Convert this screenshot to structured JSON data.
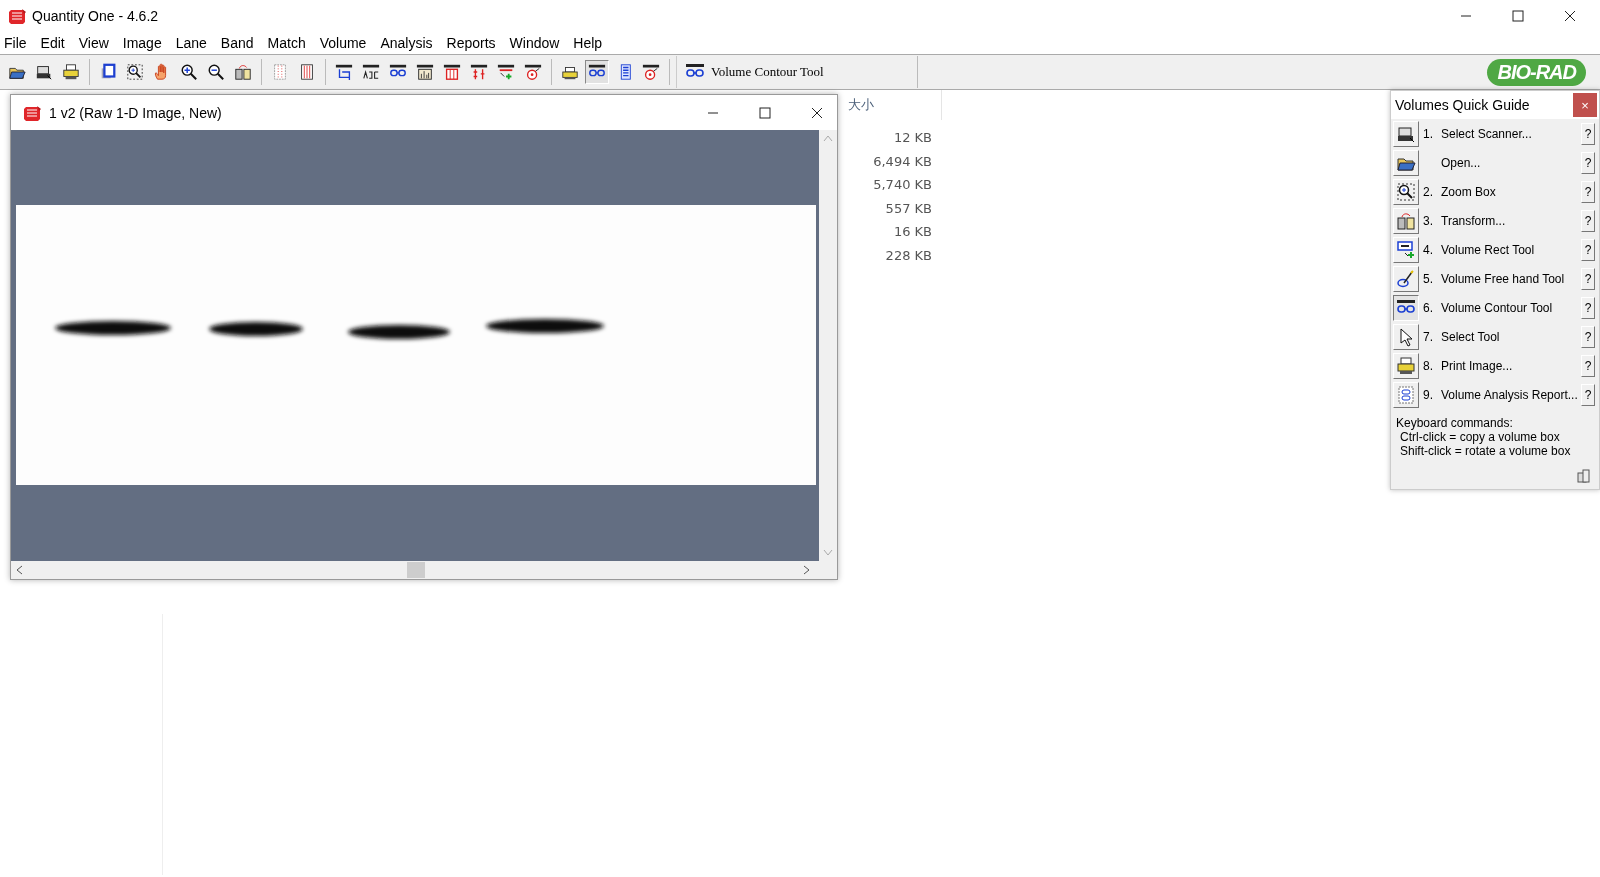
{
  "app": {
    "title": "Quantity One - 4.6.2"
  },
  "menu": [
    "File",
    "Edit",
    "View",
    "Image",
    "Lane",
    "Band",
    "Match",
    "Volume",
    "Analysis",
    "Reports",
    "Window",
    "Help"
  ],
  "toolbar": {
    "groups": [
      [
        {
          "kind": "open",
          "selected": false
        },
        {
          "kind": "scanner",
          "selected": false
        },
        {
          "kind": "print",
          "selected": false
        }
      ],
      [
        {
          "kind": "copy",
          "selected": false
        },
        {
          "kind": "zoom-box",
          "selected": false
        },
        {
          "kind": "hand",
          "selected": false
        },
        {
          "kind": "zoom-in",
          "selected": false
        },
        {
          "kind": "zoom-out",
          "selected": false
        },
        {
          "kind": "transform",
          "selected": false
        }
      ],
      [
        {
          "kind": "lanes-dotted",
          "selected": false
        },
        {
          "kind": "lanes",
          "selected": false
        }
      ],
      [
        {
          "kind": "crop-lane",
          "selected": false
        },
        {
          "kind": "label-lane",
          "selected": false
        },
        {
          "kind": "contour",
          "selected": false
        },
        {
          "kind": "histogram",
          "selected": false
        },
        {
          "kind": "lane-frame",
          "selected": false
        },
        {
          "kind": "band-match",
          "selected": false
        },
        {
          "kind": "add-band",
          "selected": false
        },
        {
          "kind": "target",
          "selected": false
        }
      ],
      [
        {
          "kind": "help-print",
          "selected": false
        },
        {
          "kind": "help-contour",
          "selected": true
        },
        {
          "kind": "help-list",
          "selected": false
        },
        {
          "kind": "help-target",
          "selected": false
        }
      ]
    ],
    "status": "Volume Contour Tool",
    "logo": "BIO-RAD"
  },
  "image_window": {
    "title": "1 v2 (Raw 1-D Image, New)"
  },
  "file_list": {
    "column_header": "大小",
    "sizes": [
      "12 KB",
      "6,494 KB",
      "5,740 KB",
      "557 KB",
      "16 KB",
      "228 KB"
    ]
  },
  "quick_guide": {
    "title": "Volumes Quick Guide",
    "close": "×",
    "items": [
      {
        "kind": "scanner",
        "number": "1.",
        "label": "Select Scanner...",
        "help": "?",
        "selected": false
      },
      {
        "kind": "open",
        "label": "Open...",
        "help": "?",
        "selected": false
      },
      {
        "kind": "zoom-box",
        "number": "2.",
        "label": "Zoom Box",
        "help": "?",
        "selected": false
      },
      {
        "kind": "transform",
        "number": "3.",
        "label": "Transform...",
        "help": "?",
        "selected": false
      },
      {
        "kind": "rect-tool",
        "number": "4.",
        "label": "Volume Rect Tool",
        "help": "?",
        "selected": false
      },
      {
        "kind": "freehand",
        "number": "5.",
        "label": "Volume Free hand Tool",
        "help": "?",
        "selected": false
      },
      {
        "kind": "contour",
        "number": "6.",
        "label": "Volume Contour Tool",
        "help": "?",
        "selected": true
      },
      {
        "kind": "pointer",
        "number": "7.",
        "label": "Select Tool",
        "help": "?",
        "selected": false
      },
      {
        "kind": "print",
        "number": "8.",
        "label": "Print Image...",
        "help": "?",
        "selected": false
      },
      {
        "kind": "report",
        "number": "9.",
        "label": "Volume Analysis Report...",
        "help": "?",
        "selected": false
      }
    ],
    "notes": [
      "Keyboard commands:",
      "Ctrl-click = copy a volume box",
      "Shift-click = rotate a volume box"
    ]
  }
}
